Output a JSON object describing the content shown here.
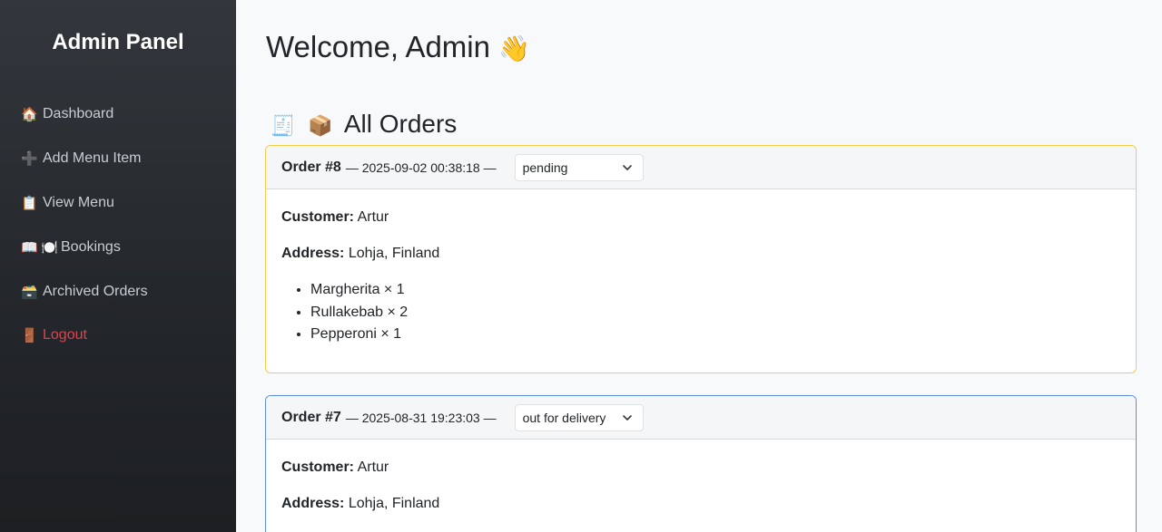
{
  "sidebar": {
    "title": "Admin Panel",
    "items": [
      {
        "icon": "house-icon",
        "glyph": "🏠",
        "label": "Dashboard"
      },
      {
        "icon": "plus-icon",
        "glyph": "➕",
        "label": "Add Menu Item"
      },
      {
        "icon": "clipboard-icon",
        "glyph": "📋",
        "label": "View Menu"
      },
      {
        "icon": "book-plate-icon",
        "glyph": "📖",
        "glyph2": "🍽️",
        "label": "Bookings"
      },
      {
        "icon": "card-box-icon",
        "glyph": "🗃️",
        "label": "Archived Orders"
      },
      {
        "icon": "door-icon",
        "glyph": "🚪",
        "label": "Logout"
      }
    ]
  },
  "main": {
    "welcome": "Welcome, Admin",
    "welcome_emoji": "👋",
    "section_emoji_1": "🧾",
    "section_emoji_2": "📦",
    "section_title": "All Orders"
  },
  "orders": [
    {
      "id_label": "Order #8",
      "timestamp": "— 2025-09-02 00:38:18 —",
      "status": "pending",
      "customer_label": "Customer:",
      "customer": "Artur",
      "address_label": "Address:",
      "address": "Lohja, Finland",
      "items": [
        "Margherita × 1",
        "Rullakebab × 2",
        "Pepperoni × 1"
      ]
    },
    {
      "id_label": "Order #7",
      "timestamp": "— 2025-08-31 19:23:03 —",
      "status": "out for delivery",
      "customer_label": "Customer:",
      "customer": "Artur",
      "address_label": "Address:",
      "address": "Lohja, Finland"
    }
  ],
  "colors": {
    "pending_border": "#f4cc4a",
    "delivery_border": "#5a8fe0",
    "logout": "#e0424f"
  }
}
